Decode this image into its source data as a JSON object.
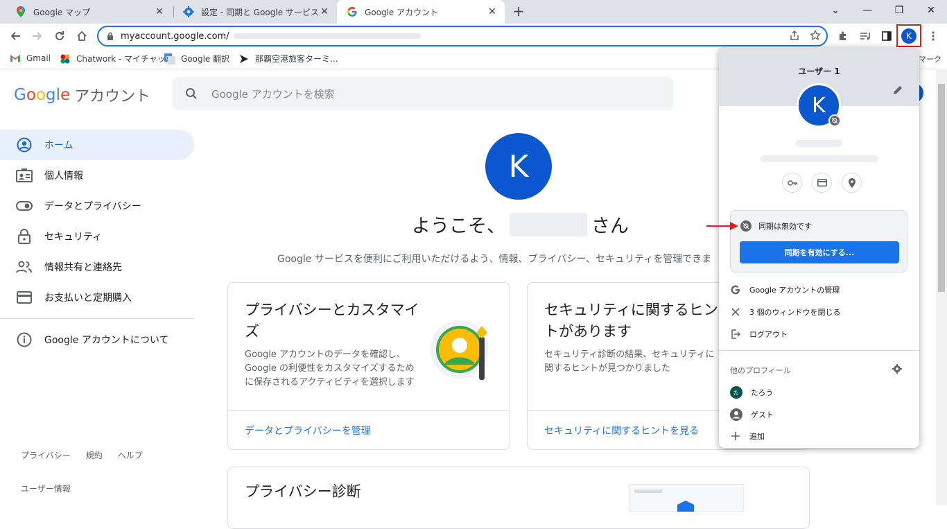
{
  "tabs": [
    {
      "title": "Google マップ",
      "close": "✕"
    },
    {
      "title": "設定 - 同期と Google サービス",
      "close": "✕"
    },
    {
      "title": "Google アカウント",
      "close": "✕"
    }
  ],
  "new_tab": "+",
  "window_controls": {
    "minimize": "—",
    "restore": "❐",
    "close": "✕",
    "dropdown": "⌄"
  },
  "address": {
    "url": "myaccount.google.com/"
  },
  "profile_button": {
    "initial": "K"
  },
  "bookmarks": [
    {
      "label": "Gmail"
    },
    {
      "label": "Chatwork - マイチャット"
    },
    {
      "label": "Google 翻訳"
    },
    {
      "label": "那覇空港旅客ターミ..."
    }
  ],
  "bookmarks_overflow": "マーク",
  "page": {
    "logo": {
      "G": "G",
      "o1": "o",
      "o2": "o",
      "g": "g",
      "l": "l",
      "e": "e",
      "suffix": "アカウント"
    },
    "search_placeholder": "Google アカウントを検索",
    "nav": [
      {
        "label": "ホーム"
      },
      {
        "label": "個人情報"
      },
      {
        "label": "データとプライバシー"
      },
      {
        "label": "セキュリティ"
      },
      {
        "label": "情報共有と連絡先"
      },
      {
        "label": "お支払いと定期購入"
      },
      {
        "label": "Google アカウントについて"
      }
    ],
    "footer": {
      "privacy": "プライバシー",
      "terms": "規約",
      "help": "ヘルプ",
      "user_info": "ユーザー情報"
    },
    "avatar_initial": "K",
    "welcome_prefix": "ようこそ、",
    "welcome_suffix": "さん",
    "subtext": "Google サービスを便利にご利用いただけるよう、情報、プライバシー、セキュリティを管理できま",
    "cards": [
      {
        "title": "プライバシーとカスタマイズ",
        "desc": "Google アカウントのデータを確認し、Google の利便性をカスタマイズするために保存されるアクティビティを選択します",
        "link": "データとプライバシーを管理"
      },
      {
        "title": "セキュリティに関するヒントがあります",
        "desc": "セキュリティ診断の結果、セキュリティに関するヒントが見つかりました",
        "link": "セキュリティに関するヒントを見る"
      },
      {
        "title": "プライバシー診断"
      }
    ]
  },
  "popup": {
    "user_name": "ユーザー 1",
    "avatar_initial": "K",
    "sync_status": "同期は無効です",
    "sync_button": "同期を有効にする...",
    "menu": [
      {
        "label": "Google アカウントの管理"
      },
      {
        "label": "3 個のウィンドウを閉じる"
      },
      {
        "label": "ログアウト"
      }
    ],
    "others_label": "他のプロフィール",
    "profiles": [
      {
        "label": "たろう",
        "initial": "た"
      },
      {
        "label": "ゲスト"
      },
      {
        "label": "追加"
      }
    ]
  },
  "colors": {
    "accent": "#1a73e8",
    "avatar": "#0b57d0",
    "highlight_border": "#e02020",
    "arrow": "#e02020"
  }
}
